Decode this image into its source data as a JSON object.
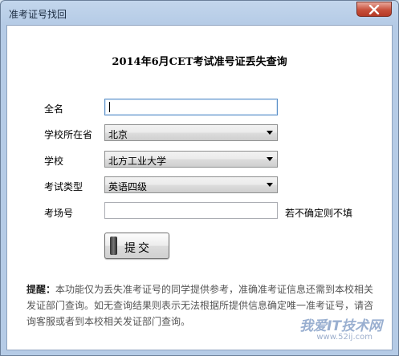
{
  "window": {
    "title": "准考证号找回"
  },
  "form": {
    "heading": "2014年6月CET考试准号证丢失查询",
    "fields": {
      "name": {
        "label": "全名",
        "value": ""
      },
      "province": {
        "label": "学校所在省",
        "value": "北京"
      },
      "school": {
        "label": "学校",
        "value": "北方工业大学"
      },
      "exam_type": {
        "label": "考试类型",
        "value": "英语四级"
      },
      "room": {
        "label": "考场号",
        "value": "",
        "hint": "若不确定则不填"
      }
    },
    "submit_label": "提交"
  },
  "notice": {
    "title": "提醒：",
    "body": "本功能仅为丢失准考证号的同学提供参考，准确准考证信息还需到本校相关发证部门查询。如无查询结果则表示无法根据所提供信息确定唯一准考证号，请咨询客服或者到本校相关发证部门查询。"
  },
  "watermark": {
    "text": "我爱IT技术网",
    "sub": "www.52ij.com"
  },
  "colors": {
    "close_button": "#c7503b",
    "frame": "#b5cbe6"
  }
}
